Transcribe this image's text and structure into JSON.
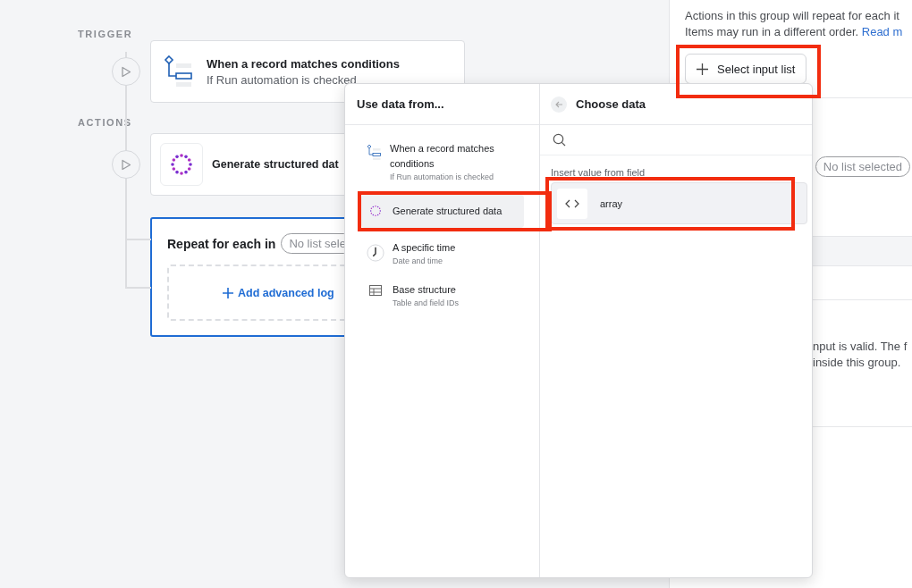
{
  "trigger": {
    "section_label": "TRIGGER",
    "title": "When a record matches conditions",
    "subtitle": "If Run automation is checked"
  },
  "actions": {
    "section_label": "ACTIONS",
    "step": {
      "title": "Generate structured dat"
    },
    "repeat": {
      "title": "Repeat for each in",
      "list_pill": "No list sele",
      "add_button": "Add advanced log",
      "selected": true
    }
  },
  "side_panel": {
    "description_lines": [
      "Actions in this group will repeat for each it",
      "Items may run in a different order."
    ],
    "link": "Read m",
    "select_button": {
      "label": "Select input list",
      "highlighted": true
    },
    "list_pill": "No list selected",
    "note_lines": [
      "nput is valid. The f",
      "inside this group."
    ]
  },
  "data_picker": {
    "sources_title": "Use data from...",
    "sources": [
      {
        "kind": "trigger",
        "title": "When a record matches conditions",
        "subtitle": "If Run automation is checked",
        "selected": false,
        "highlighted": false
      },
      {
        "kind": "generate",
        "title": "Generate structured data",
        "selected": true,
        "highlighted": true
      },
      {
        "kind": "time",
        "title": "A specific time",
        "subtitle": "Date and time",
        "selected": false,
        "highlighted": false
      },
      {
        "kind": "table",
        "title": "Base structure",
        "subtitle": "Table and field IDs",
        "selected": false,
        "highlighted": false
      }
    ],
    "fields_title": "Choose data",
    "section_label": "Insert value from field",
    "fields": [
      {
        "label": "array",
        "highlighted": true
      }
    ]
  }
}
